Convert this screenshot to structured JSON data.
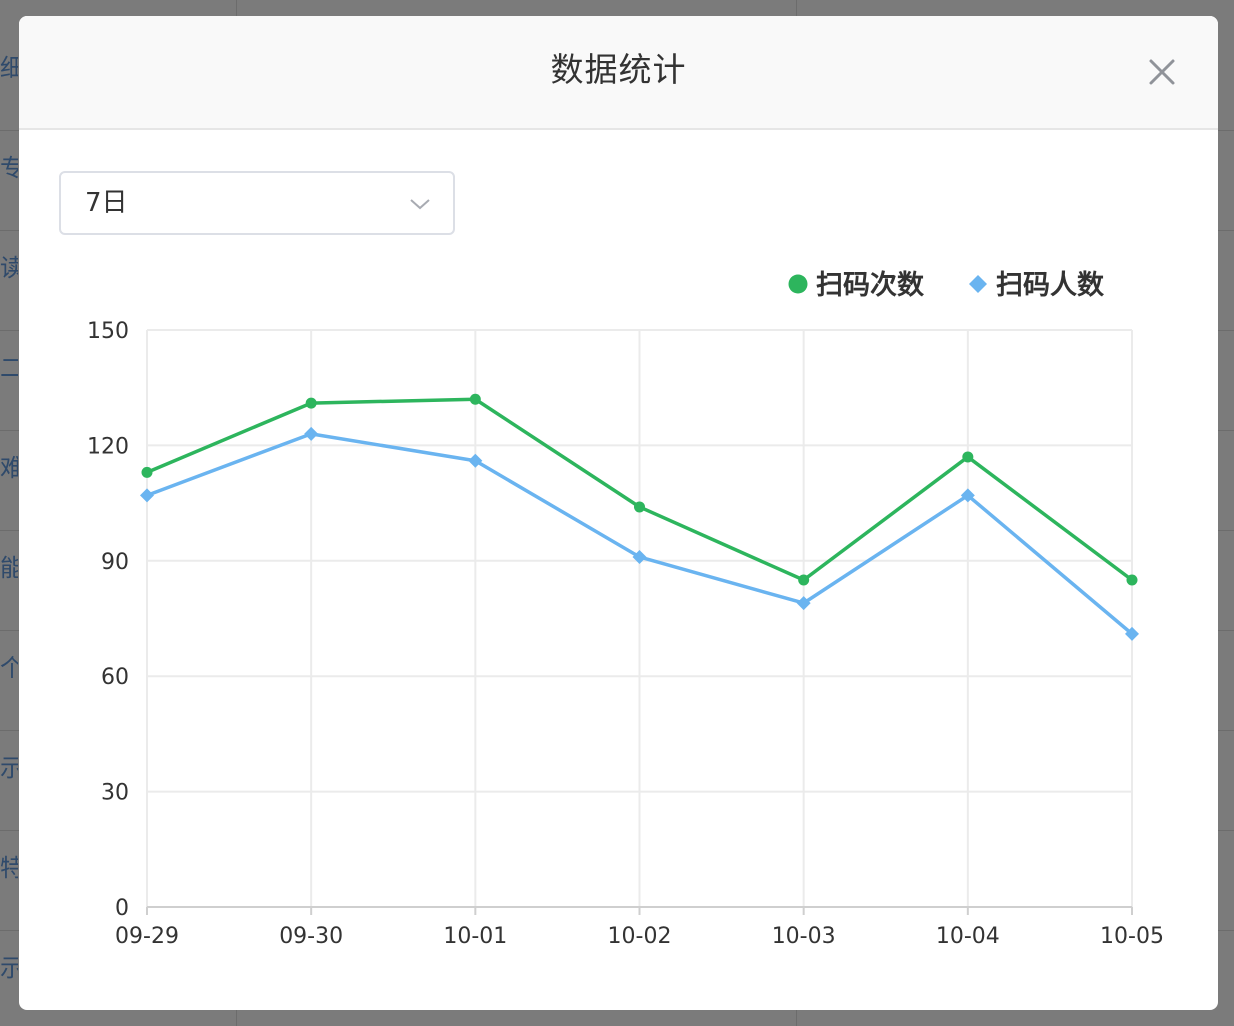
{
  "background": {
    "side_snippets": [
      "细",
      "专",
      "读",
      "二",
      "难",
      "能",
      "个",
      "示",
      "特",
      "示"
    ]
  },
  "dialog": {
    "title": "数据统计",
    "close_icon": "close-icon"
  },
  "filter": {
    "selected": "7日",
    "arrow_icon": "chevron-down-icon"
  },
  "chart_data": {
    "type": "line",
    "categories": [
      "09-29",
      "09-30",
      "10-01",
      "10-02",
      "10-03",
      "10-04",
      "10-05"
    ],
    "series": [
      {
        "name": "扫码次数",
        "values": [
          113,
          131,
          132,
          104,
          85,
          117,
          85
        ],
        "color": "#2db55d",
        "marker": "circle"
      },
      {
        "name": "扫码人数",
        "values": [
          107,
          123,
          116,
          91,
          79,
          107,
          71
        ],
        "color": "#6ab4f0",
        "marker": "diamond"
      }
    ],
    "yticks": [
      0,
      30,
      60,
      90,
      120,
      150
    ],
    "ylim": [
      0,
      150
    ],
    "grid": true,
    "legend_position": "top-right",
    "title": "",
    "xlabel": "",
    "ylabel": ""
  }
}
